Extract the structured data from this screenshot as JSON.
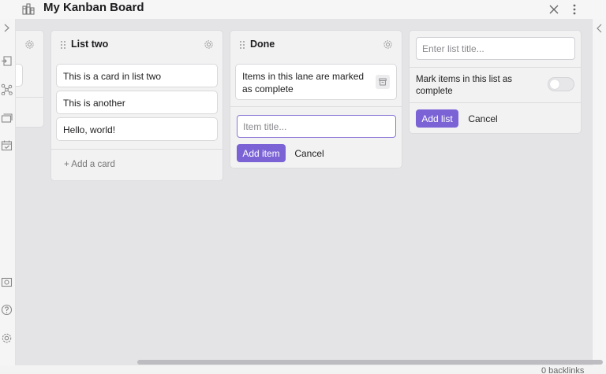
{
  "window": {
    "title": "My Kanban Board"
  },
  "lanes": {
    "partial_lane": {
      "cards": [
        ""
      ]
    },
    "list_two": {
      "title": "List two",
      "cards": [
        "This is a card in list two",
        "This is another",
        "Hello, world!"
      ],
      "add_card_label": "+ Add a card"
    },
    "done": {
      "title": "Done",
      "info_card": "Items in this lane are marked as complete",
      "item_input_placeholder": "Item title...",
      "add_item_label": "Add item",
      "cancel_label": "Cancel"
    },
    "new_list": {
      "title_placeholder": "Enter list title...",
      "mark_complete_label": "Mark items in this list as complete",
      "mark_complete_enabled": false,
      "add_list_label": "Add list",
      "cancel_label": "Cancel"
    }
  },
  "status": {
    "backlinks": "0 backlinks"
  },
  "colors": {
    "accent": "#7b63d6",
    "board_bg": "#e4e4e6",
    "lane_bg": "#f2f2f3"
  },
  "icons": {
    "title": "kanban-board-icon",
    "ribbon": [
      "expand-icon",
      "open-quick-switcher-icon",
      "graph-view-icon",
      "cards-icon",
      "calendar-icon",
      "vault-icon",
      "help-icon",
      "settings-icon"
    ]
  }
}
